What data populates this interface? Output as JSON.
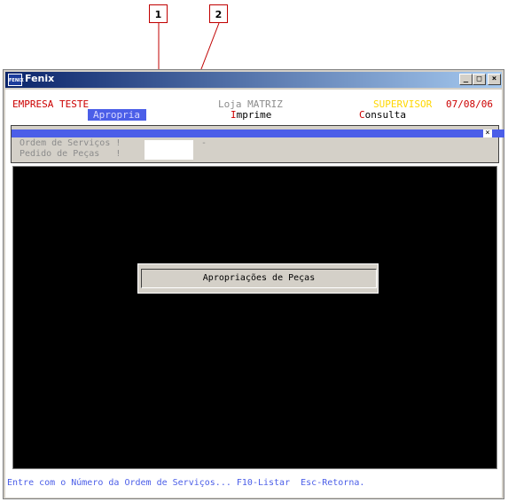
{
  "callouts": [
    "1",
    "2"
  ],
  "window": {
    "title": "Fenix",
    "icon": "fenix-app-icon",
    "icon_text": "FENIX",
    "buttons": [
      "minimize",
      "maximize",
      "close"
    ]
  },
  "header": {
    "company": "EMPRESA TESTE",
    "store": "Loja MATRIZ",
    "user": "SUPERVISOR",
    "date": "07/08/06"
  },
  "menu": [
    {
      "label": "Apropria",
      "selected": true
    },
    {
      "hotkey": "I",
      "rest": "mprime"
    },
    {
      "hotkey": "C",
      "rest": "onsulta"
    }
  ],
  "form": {
    "ordem_label": "Ordem de Serviços !",
    "ordem_dash": "-",
    "pedido_label": "Pedido de Peças   !",
    "close_glyph": "×"
  },
  "dialog": {
    "title": "Apropriações de Peças"
  },
  "status_line": "Entre com o Número da Ordem de Serviços... F10-Listar  Esc-Retorna.",
  "colors": {
    "accent_blue": "#4b5ee8",
    "hotkey_red": "#cc0000",
    "user_yellow": "#ffd700",
    "screen_black": "#000000"
  }
}
